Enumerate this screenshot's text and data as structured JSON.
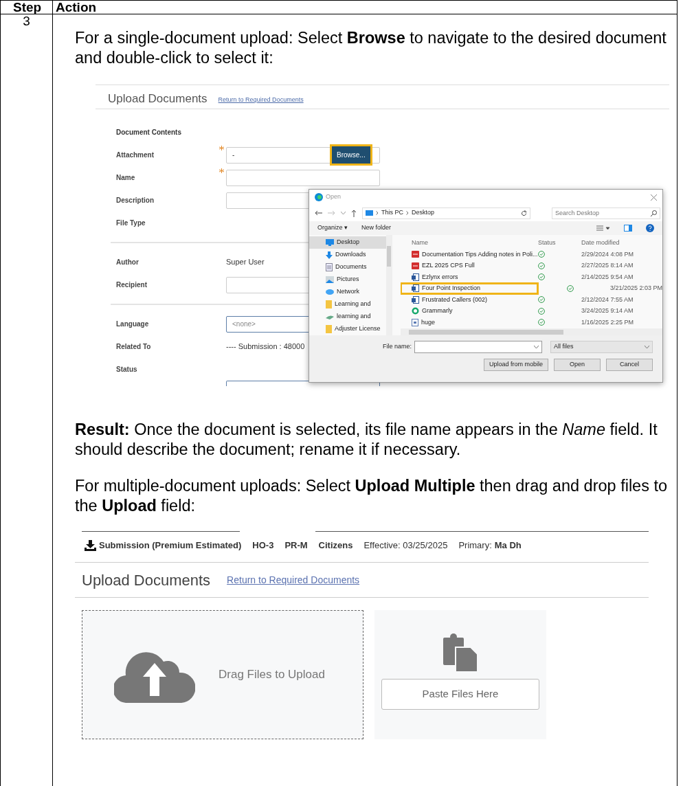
{
  "table": {
    "columns": [
      "Step",
      "Action"
    ],
    "step": "3",
    "intro": "For a single-document upload: Select **Browse** to navigate to the desired document and double-click to select it:",
    "screenshot_1": {
      "title": "Upload Documents",
      "link": "Return to Required Documents",
      "section": "Document Contents",
      "fields": [
        {
          "label": "Attachment",
          "kind": "input",
          "required": true,
          "value": "-",
          "button": "Browse..."
        },
        {
          "label": "Name",
          "kind": "input",
          "required": true
        },
        {
          "label": "Description",
          "kind": "input",
          "required": false
        },
        {
          "label": "File Type",
          "kind": "blank",
          "required": false
        },
        {
          "kind": "divider"
        },
        {
          "label": "Author",
          "kind": "text",
          "required": false,
          "value": "Super User"
        },
        {
          "label": "Recipient",
          "kind": "input",
          "required": false
        },
        {
          "kind": "divider"
        },
        {
          "label": "Language",
          "kind": "select",
          "required": false,
          "value": "<none>"
        },
        {
          "label": "Related To",
          "kind": "text",
          "required": false,
          "value": "---- Submission : 48000"
        },
        {
          "label": "Status",
          "kind": "blank",
          "required": false
        }
      ],
      "dialog": {
        "title": "Open",
        "path": [
          "This PC",
          "Desktop"
        ],
        "search_placeholder": "Search Desktop",
        "organize": "Organize ▾",
        "new_folder": "New folder",
        "sidebar": [
          {
            "label": "Desktop",
            "kind": "desktop",
            "selected": true
          },
          {
            "label": "Downloads",
            "kind": "download",
            "selected": false
          },
          {
            "label": "Documents",
            "kind": "documents",
            "selected": false
          },
          {
            "label": "Pictures",
            "kind": "pictures",
            "selected": false
          },
          {
            "label": "Network",
            "kind": "network",
            "selected": false
          },
          {
            "label": "Learning and",
            "kind": "folder",
            "selected": false
          },
          {
            "label": "learning and",
            "kind": "bird",
            "selected": false
          },
          {
            "label": "Adjuster License",
            "kind": "folder",
            "selected": false
          }
        ],
        "columns": [
          "Name",
          "Status",
          "Date modified"
        ],
        "files": [
          {
            "name": "Documentation Tips Adding notes in Poli...",
            "kind": "pdf",
            "date": "2/29/2024 4:08 PM",
            "selected": false
          },
          {
            "name": "EZL 2025 CPS Full",
            "kind": "pdf",
            "date": "2/27/2025 8:14 AM",
            "selected": false
          },
          {
            "name": "Ezlynx errors",
            "kind": "doc",
            "date": "2/14/2025 9:54 AM",
            "selected": false
          },
          {
            "name": "Four Point Inspection",
            "kind": "doc",
            "date": "3/21/2025 2:03 PM",
            "selected": true
          },
          {
            "name": "Frustrated Callers (002)",
            "kind": "doc",
            "date": "2/12/2024 7:55 AM",
            "selected": false
          },
          {
            "name": "Grammarly",
            "kind": "app",
            "date": "3/24/2025 9:14 AM",
            "selected": false
          },
          {
            "name": "huge",
            "kind": "file",
            "date": "1/16/2025 2:25 PM",
            "selected": false
          }
        ],
        "file_name_label": "File name:",
        "file_type": "All files",
        "buttons": [
          "Upload from mobile",
          "Open",
          "Cancel"
        ]
      }
    },
    "result": "**Result:** Once the document is selected, its file name appears in the *Name* field. It should describe the document; rename it if necessary.",
    "multi": "For multiple-document uploads: Select **Upload Multiple** then drag and drop files to the **Upload** field:",
    "screenshot_2": {
      "header": [
        {
          "text": "Submission (Premium Estimated)",
          "bold": true
        },
        {
          "text": "HO-3",
          "bold": true
        },
        {
          "text": "PR-M",
          "bold": true
        },
        {
          "text": "Citizens",
          "bold": true
        },
        {
          "text": "Effective: 03/25/2025",
          "bold": false
        },
        {
          "text": "Primary:",
          "bold": false
        },
        {
          "text": "Ma Dh",
          "bold": true
        }
      ],
      "title": "Upload Documents",
      "link": "Return to Required Documents",
      "dropzone": "Drag Files to Upload",
      "paste_button": "Paste Files Here"
    }
  }
}
